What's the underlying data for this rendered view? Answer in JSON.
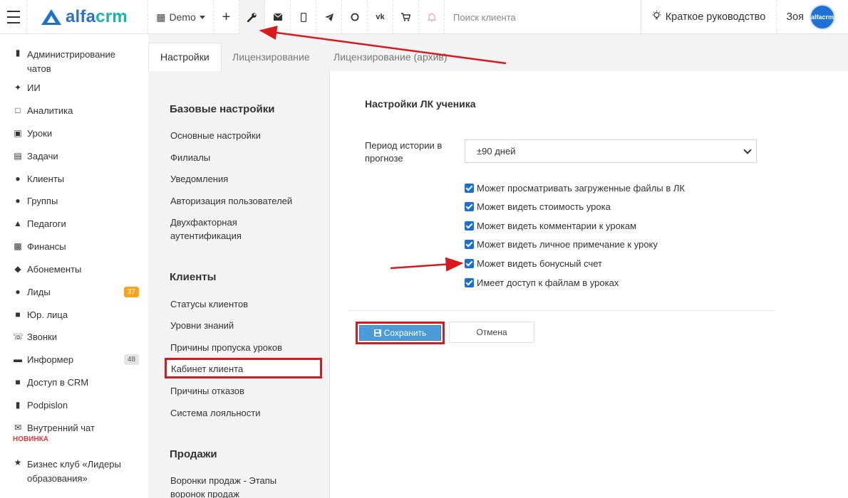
{
  "topbar": {
    "logo_text": "alfa",
    "logo_text_crm": "crm",
    "org_selector": "Demo",
    "search_placeholder": "Поиск клиента",
    "guide_label": "Краткое руководство",
    "user_name": "Зоя",
    "avatar_text": "alfacrm",
    "icons": [
      "menu-icon",
      "plus-icon",
      "wrench-icon",
      "envelope-icon",
      "mobile-icon",
      "telegram-icon",
      "whatsapp-icon",
      "vk-icon",
      "cart-icon",
      "bell-icon",
      "lightbulb-icon"
    ]
  },
  "sidebar": {
    "items": [
      {
        "label": "Администрирование чатов",
        "icon": "chat-icon"
      },
      {
        "label": "ИИ",
        "icon": "sparkle-icon"
      },
      {
        "label": "Аналитика",
        "icon": "map-icon"
      },
      {
        "label": "Уроки",
        "icon": "calendar-icon"
      },
      {
        "label": "Задачи",
        "icon": "clipboard-icon"
      },
      {
        "label": "Клиенты",
        "icon": "user-icon"
      },
      {
        "label": "Группы",
        "icon": "users-icon"
      },
      {
        "label": "Педагоги",
        "icon": "graduation-cap-icon"
      },
      {
        "label": "Финансы",
        "icon": "money-icon"
      },
      {
        "label": "Абонементы",
        "icon": "tag-icon"
      },
      {
        "label": "Лиды",
        "icon": "user-plus-icon",
        "badge": "37"
      },
      {
        "label": "Юр. лица",
        "icon": "briefcase-icon"
      },
      {
        "label": "Звонки",
        "icon": "phone-icon"
      },
      {
        "label": "Информер",
        "icon": "inbox-icon",
        "badge": "48"
      },
      {
        "label": "Доступ в CRM",
        "icon": "lock-icon"
      },
      {
        "label": "Podpislon",
        "icon": "file-icon"
      },
      {
        "label": "Внутренний чат",
        "icon": "envelope-icon",
        "tag": "НОВИНКА"
      },
      {
        "label": "Бизнес клуб «Лидеры образования»",
        "icon": "star-icon"
      }
    ]
  },
  "tabs": [
    {
      "label": "Настройки",
      "active": true
    },
    {
      "label": "Лицензирование",
      "active": false
    },
    {
      "label": "Лицензирование (архив)",
      "active": false
    }
  ],
  "settings_menu": {
    "sections": [
      {
        "title": "Базовые настройки",
        "links": [
          "Основные настройки",
          "Филиалы",
          "Уведомления",
          "Авторизация пользователей",
          "Двухфакторная аутентификация"
        ]
      },
      {
        "title": "Клиенты",
        "links": [
          "Статусы клиентов",
          "Уровни знаний",
          "Причины пропуска уроков",
          "Кабинет клиента",
          "Причины отказов",
          "Система лояльности"
        ]
      },
      {
        "title": "Продажи",
        "links": [
          "Воронки продаж - Этапы воронок продаж"
        ]
      }
    ],
    "selected": "Кабинет клиента"
  },
  "content": {
    "title": "Настройки ЛК ученика",
    "period_label": "Период истории в прогнозе",
    "period_value": "±90 дней",
    "checkboxes": [
      {
        "label": "Может просматривать загруженные файлы в ЛК",
        "checked": true
      },
      {
        "label": "Может видеть стоимость урока",
        "checked": true
      },
      {
        "label": "Может видеть комментарии к урокам",
        "checked": true
      },
      {
        "label": "Может видеть личное примечание к уроку",
        "checked": true
      },
      {
        "label": "Может видеть бонусный счет",
        "checked": true
      },
      {
        "label": "Имеет доступ к файлам в уроках",
        "checked": true
      }
    ],
    "save_label": "Сохранить",
    "cancel_label": "Отмена"
  },
  "colors": {
    "brand_blue": "#2e6fd0",
    "brand_teal": "#19b4a4",
    "primary_button": "#4a9bd7",
    "annotation_red": "#d9191d",
    "badge_orange": "#f8a51b",
    "checkbox_blue": "#1a6fd6"
  }
}
